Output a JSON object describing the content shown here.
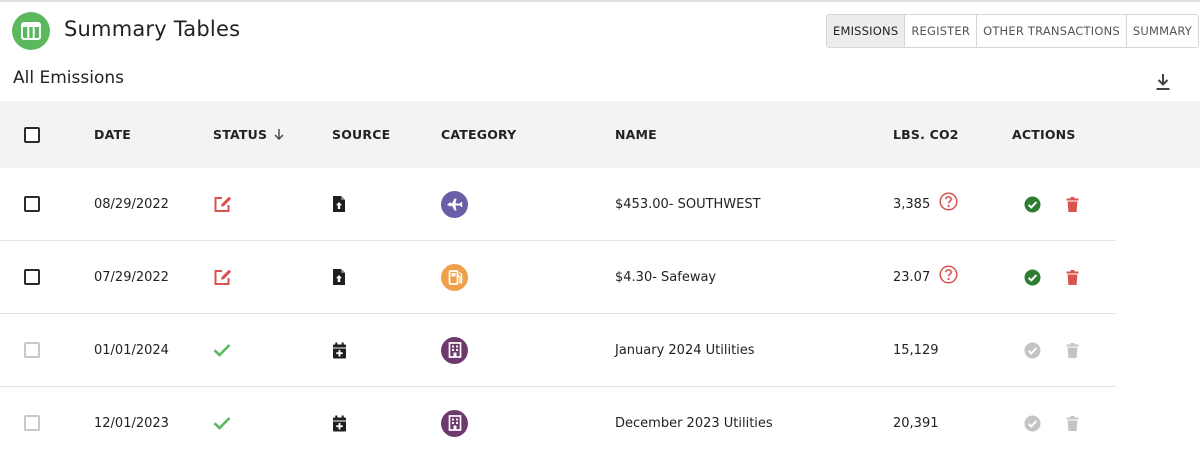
{
  "header": {
    "title": "Summary Tables"
  },
  "tabs": [
    {
      "label": "EMISSIONS",
      "active": true
    },
    {
      "label": "REGISTER",
      "active": false
    },
    {
      "label": "OTHER TRANSACTIONS",
      "active": false
    },
    {
      "label": "SUMMARY",
      "active": false
    }
  ],
  "section": {
    "title": "All Emissions"
  },
  "table": {
    "columns": {
      "date": "DATE",
      "status": "STATUS",
      "source": "SOURCE",
      "category": "CATEGORY",
      "name": "NAME",
      "lbs": "LBS. CO2",
      "actions": "ACTIONS"
    },
    "rows": [
      {
        "date": "08/29/2022",
        "status": "edit",
        "source": "file-upload",
        "category": "airplane",
        "name": "$453.00- SOUTHWEST",
        "lbs": "3,385",
        "flag": true,
        "enabled": true
      },
      {
        "date": "07/29/2022",
        "status": "edit",
        "source": "file-upload",
        "category": "gas-pump",
        "name": "$4.30- Safeway",
        "lbs": "23.07",
        "flag": true,
        "enabled": true
      },
      {
        "date": "01/01/2024",
        "status": "check",
        "source": "calendar-add",
        "category": "building",
        "name": "January 2024 Utilities",
        "lbs": "15,129",
        "flag": false,
        "enabled": false
      },
      {
        "date": "12/01/2023",
        "status": "check",
        "source": "calendar-add",
        "category": "building",
        "name": "December 2023 Utilities",
        "lbs": "20,391",
        "flag": false,
        "enabled": false
      }
    ]
  },
  "colors": {
    "accent_green": "#5cb85c",
    "approve_green": "#2e7d32",
    "delete_red": "#d9534f",
    "airplane_purple": "#6b5ea8",
    "gas_orange": "#f0a04b",
    "building_plum": "#6e3a6e",
    "disabled_gray": "#c4c4c4"
  }
}
